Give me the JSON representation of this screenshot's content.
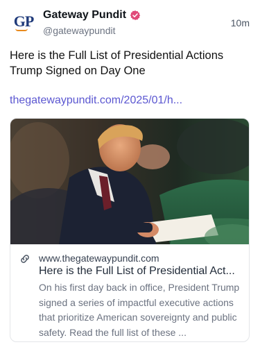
{
  "author": {
    "avatar_text": "GP",
    "name": "Gateway Pundit",
    "handle": "@gatewaypundit",
    "verified": true
  },
  "timestamp": "10m",
  "post": {
    "text": "Here is the Full List of Presidential Actions Trump Signed on Day One",
    "link": "thegatewaypundit.com/2025/01/h..."
  },
  "card": {
    "domain": "www.thegatewaypundit.com",
    "title": "Here is the Full List of Presidential Act...",
    "description": "On his first day back in office, President Trump signed a series of impactful executive actions that prioritize American sovereignty and public safety. Read the full list of these ..."
  },
  "colors": {
    "link": "#5b57d1",
    "verified": "#e04a79",
    "logo_blue": "#1f3a7a",
    "logo_orange": "#e88a1d"
  },
  "icons": {
    "verified": "verified-badge-icon",
    "link": "link-icon"
  }
}
